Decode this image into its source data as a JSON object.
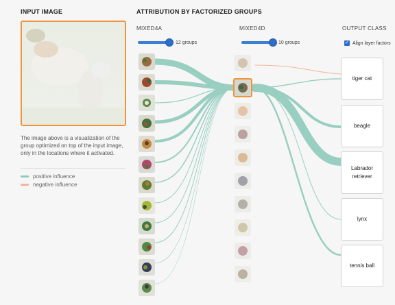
{
  "headers": {
    "input_image": "INPUT IMAGE",
    "attribution": "ATTRIBUTION BY FACTORIZED GROUPS"
  },
  "columns": {
    "mixed4a": "MIXED4A",
    "mixed4d": "MIXED4D",
    "output_class": "OUTPUT CLASS"
  },
  "sliders": {
    "mixed4a_label": "12 groups",
    "mixed4a_value": 12,
    "mixed4d_label": "10 groups",
    "mixed4d_value": 10
  },
  "align_checkbox": {
    "label": "Align layer factors",
    "checked": true
  },
  "description": "The image above is a visualization of the group optimized on top of the input image, only in the locations where it activated.",
  "legend": {
    "positive": "positive influence",
    "negative": "negative influence",
    "positive_color": "#8fcbbc",
    "negative_color": "#f5b49b"
  },
  "outputs": [
    "tiger cat",
    "beagle",
    "Labrador retriever",
    "lynx",
    "tennis ball"
  ],
  "colors": {
    "accent": "#f0943c",
    "slider": "#2d6fc7"
  }
}
